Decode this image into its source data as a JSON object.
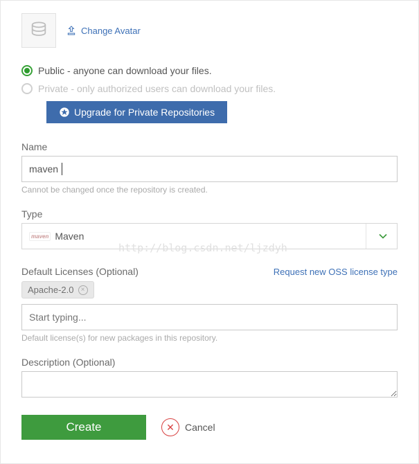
{
  "avatar": {
    "change_label": "Change Avatar"
  },
  "visibility": {
    "public_label": "Public - anyone can download your files.",
    "private_label": "Private - only authorized users can download your files.",
    "upgrade_label": "Upgrade for Private Repositories"
  },
  "name": {
    "label": "Name",
    "value": "maven",
    "helper": "Cannot be changed once the repository is created."
  },
  "type": {
    "label": "Type",
    "selected": "Maven",
    "logo_text": "maven"
  },
  "licenses": {
    "label": "Default Licenses (Optional)",
    "request_link": "Request new OSS license type",
    "chip": "Apache-2.0",
    "placeholder": "Start typing...",
    "helper": "Default license(s) for new packages in this repository."
  },
  "description": {
    "label": "Description (Optional)",
    "value": ""
  },
  "actions": {
    "create": "Create",
    "cancel": "Cancel"
  },
  "watermark": "http://blog.csdn.net/ljzdyh"
}
